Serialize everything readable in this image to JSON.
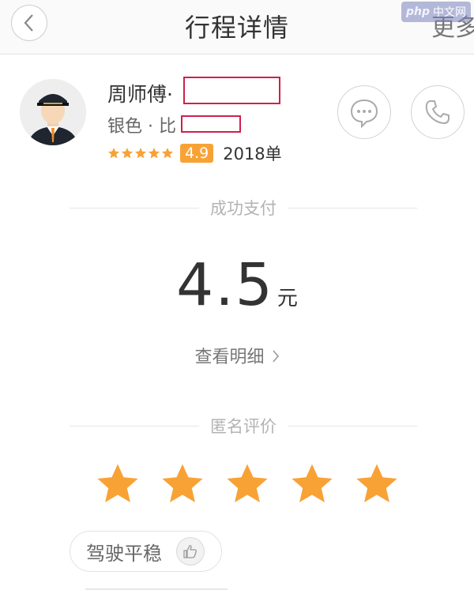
{
  "header": {
    "title": "行程详情",
    "more": "更多",
    "watermark_php": "php",
    "watermark_site": "中文网"
  },
  "driver": {
    "name": "周师傅·",
    "car": "银色 · 比",
    "score": "4.9",
    "orders": "2018单",
    "mini_stars": 5
  },
  "payment": {
    "status_label": "成功支付",
    "amount": "4.5",
    "unit": "元",
    "detail_link": "查看明细"
  },
  "review": {
    "label": "匿名评价",
    "stars": 5,
    "tag": "驾驶平稳"
  },
  "colors": {
    "star": "#f8a236",
    "redact_border": "#d0204a"
  }
}
